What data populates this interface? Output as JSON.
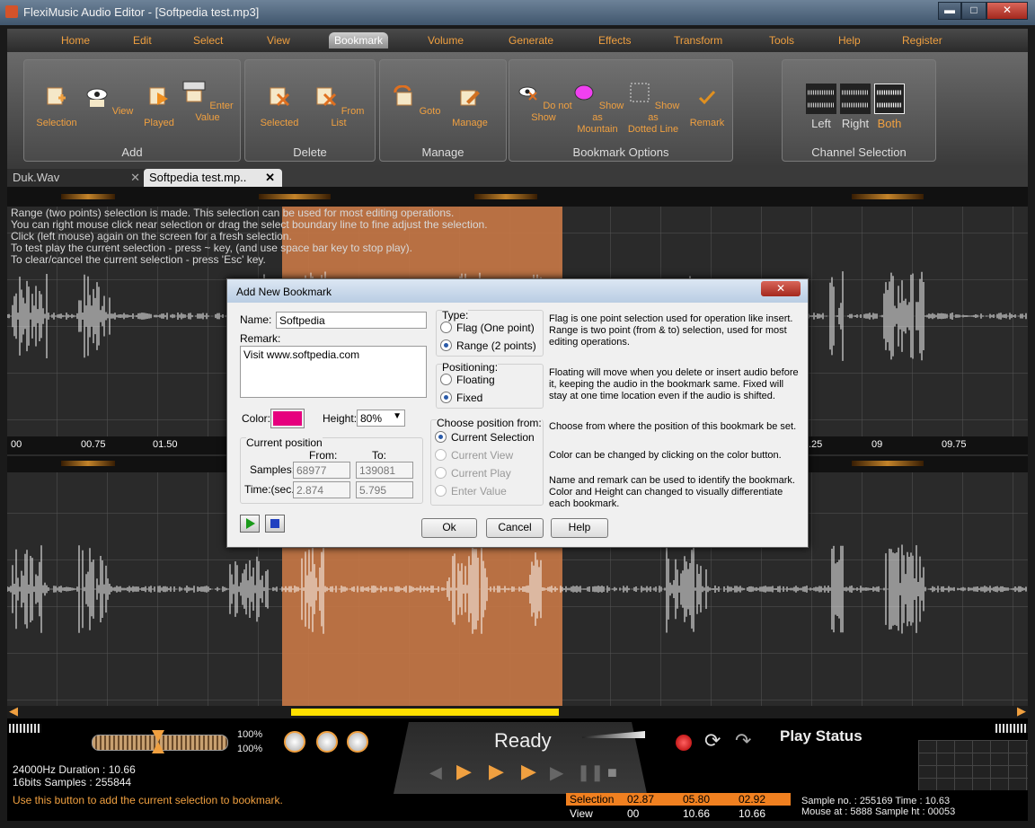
{
  "window": {
    "title": "FlexiMusic Audio Editor - [Softpedia test.mp3]",
    "min": "▬",
    "max": "□",
    "close": "✕"
  },
  "menu": [
    "Home",
    "Edit",
    "Select",
    "View",
    "Bookmark",
    "Volume",
    "Generate",
    "Effects",
    "Transform",
    "Tools",
    "Help",
    "Register"
  ],
  "ribbon": {
    "add": {
      "title": "Add",
      "buttons": [
        "Selection",
        "View",
        "Played",
        "Enter\nValue"
      ]
    },
    "delete": {
      "title": "Delete",
      "buttons": [
        "Selected",
        "From List"
      ]
    },
    "manage": {
      "title": "Manage",
      "buttons": [
        "Goto",
        "Manage"
      ]
    },
    "options": {
      "title": "Bookmark Options",
      "buttons": [
        "Do not\nShow",
        "Show as\nMountain",
        "Show as\nDotted Line",
        "Remark"
      ]
    },
    "channel": {
      "title": "Channel Selection",
      "buttons": [
        "Left",
        "Right",
        "Both"
      ]
    }
  },
  "tabs": [
    {
      "label": "Duk.Wav",
      "close": "✕"
    },
    {
      "label": "Softpedia test.mp..",
      "close": "✕"
    }
  ],
  "hint": [
    "Range (two points) selection is made. This selection can be used for most editing operations.",
    "You can right mouse click near selection or drag the select boundary line to fine adjust the selection.",
    "Click (left mouse) again on the screen for a fresh selection.",
    "To test play the current selection - press ~ key, (and use space bar key to stop play).",
    "To clear/cancel the current selection - press 'Esc' key."
  ],
  "timeline": {
    "left": [
      "00",
      "00.75",
      "01.50"
    ],
    "right": [
      ".25",
      "09",
      "09.75"
    ]
  },
  "dialog": {
    "title": "Add New Bookmark",
    "close": "✕",
    "name_label": "Name:",
    "name_value": "Softpedia",
    "remark_label": "Remark:",
    "remark_value": "Visit www.softpedia.com",
    "color_label": "Color:",
    "color_value": "#e6007e",
    "height_label": "Height:",
    "height_value": "80%",
    "current_position": "Current position",
    "from_label": "From:",
    "to_label": "To:",
    "samples_label": "Samples:",
    "samples_from": "68977",
    "samples_to": "139081",
    "time_label": "Time:(sec.)",
    "time_from": "2.874",
    "time_to": "5.795",
    "type_label": "Type:",
    "type_flag": "Flag (One point)",
    "type_range": "Range (2 points)",
    "positioning_label": "Positioning:",
    "pos_floating": "Floating",
    "pos_fixed": "Fixed",
    "choose_label": "Choose position from:",
    "choose_current_selection": "Current Selection",
    "choose_current_view": "Current View",
    "choose_current_play": "Current Play",
    "choose_enter_value": "Enter Value",
    "ok": "Ok",
    "cancel": "Cancel",
    "help": "Help",
    "help_type": "Flag is one point selection used for operation like insert. Range is two point (from & to) selection, used for most editing operations.",
    "help_positioning": "Floating will move when you delete or insert audio before it, keeping the audio in the bookmark same. Fixed will stay at one time location even if the audio is shifted.",
    "help_choose": "Choose from where the position of this bookmark be set.",
    "help_color": "Color can be changed by clicking on the color button.",
    "help_name": "Name and remark can be used to identify the bookmark. Color and Height can changed to visually differentiate each bookmark."
  },
  "bottom": {
    "vol1": "100%",
    "vol2": "100%",
    "format_line1": "24000Hz  Duration : 10.66",
    "format_line2": "16bits  Samples : 255844",
    "status_hint": "Use this button to add the current selection to bookmark.",
    "ready": "Ready",
    "play_status": "Play Status",
    "table": {
      "sel_label": "Selection",
      "sel": [
        "02.87",
        "05.80",
        "02.92"
      ],
      "view_label": "View",
      "view": [
        "00",
        "10.66",
        "10.66"
      ]
    },
    "sample_line1": "Sample no. : 255169  Time : 10.63",
    "sample_line2": "Mouse at : 5888   Sample ht : 00053"
  },
  "colors": {
    "accent": "#f0a040",
    "selection": "#c87846",
    "bookmark": "#e6007e",
    "scroll": "#ffe000"
  }
}
